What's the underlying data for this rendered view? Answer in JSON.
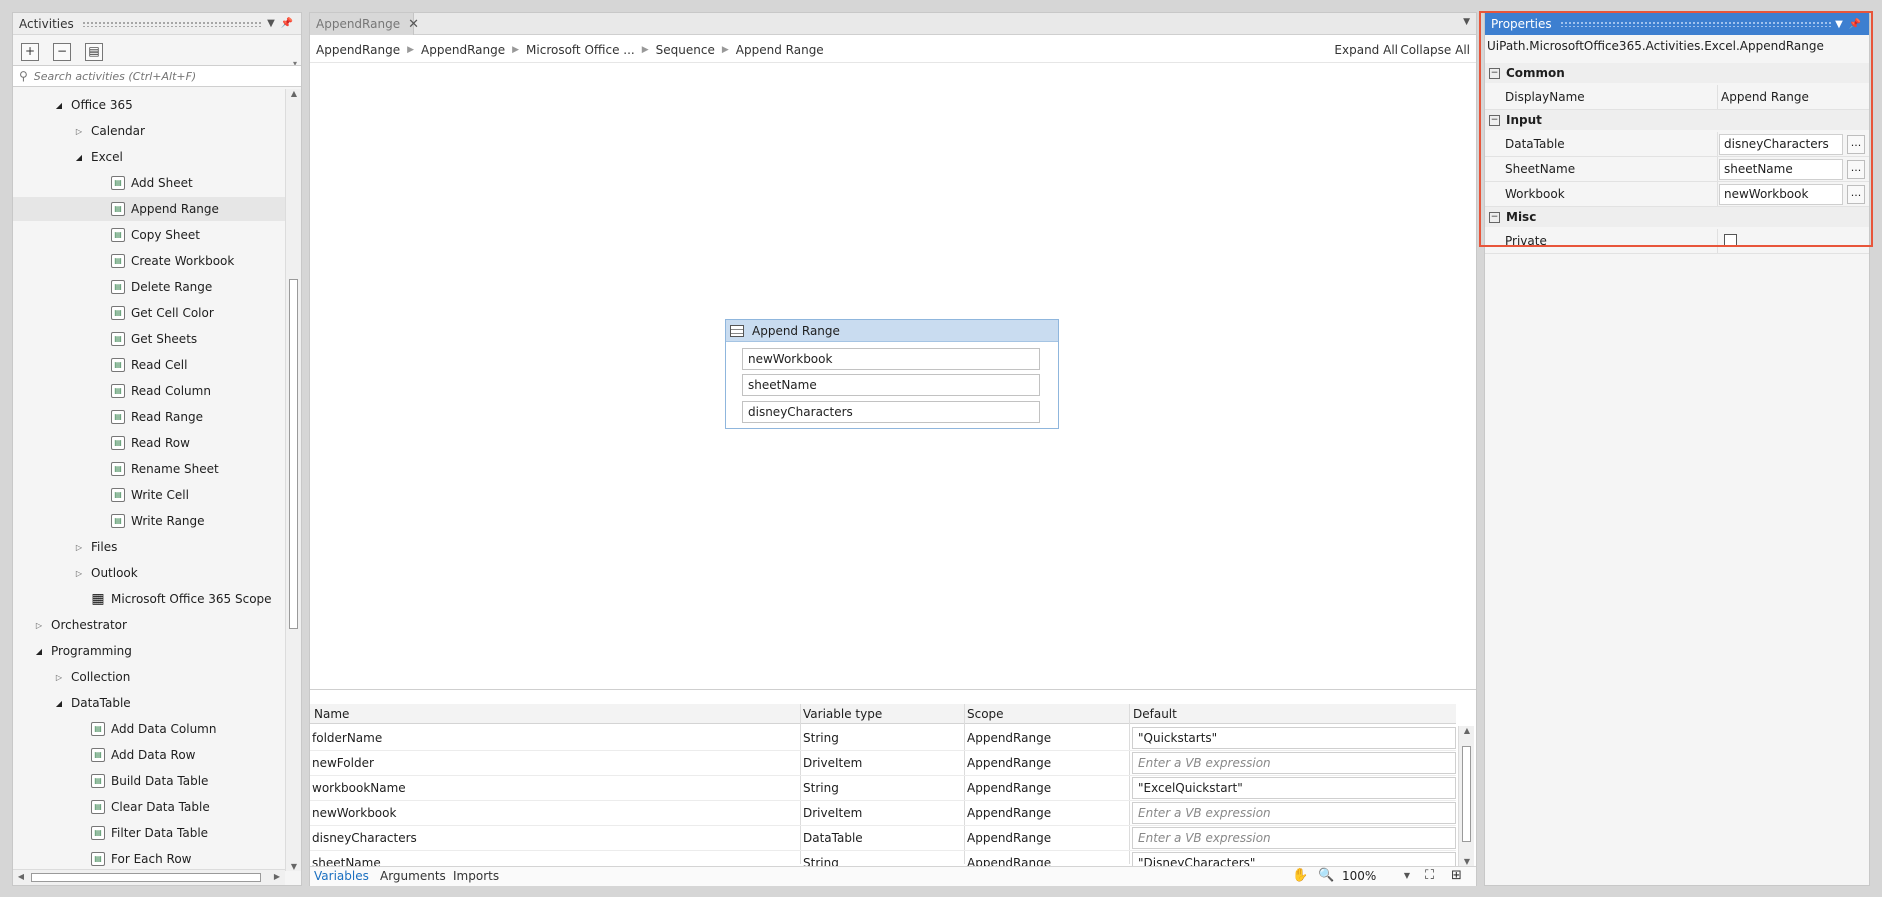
{
  "activities": {
    "title": "Activities",
    "search_placeholder": "Search activities (Ctrl+Alt+F)",
    "tree": [
      {
        "label": "Office 365",
        "indent": 1,
        "toggle": "open"
      },
      {
        "label": "Calendar",
        "indent": 2,
        "toggle": "closed"
      },
      {
        "label": "Excel",
        "indent": 2,
        "toggle": "open"
      },
      {
        "label": "Add Sheet",
        "indent": 3,
        "icon": "add-sheet-icon"
      },
      {
        "label": "Append Range",
        "indent": 3,
        "icon": "append-range-icon",
        "selected": true
      },
      {
        "label": "Copy Sheet",
        "indent": 3,
        "icon": "copy-sheet-icon"
      },
      {
        "label": "Create Workbook",
        "indent": 3,
        "icon": "create-workbook-icon"
      },
      {
        "label": "Delete Range",
        "indent": 3,
        "icon": "delete-range-icon"
      },
      {
        "label": "Get Cell Color",
        "indent": 3,
        "icon": "get-cell-color-icon"
      },
      {
        "label": "Get Sheets",
        "indent": 3,
        "icon": "get-sheets-icon"
      },
      {
        "label": "Read Cell",
        "indent": 3,
        "icon": "read-cell-icon"
      },
      {
        "label": "Read Column",
        "indent": 3,
        "icon": "read-column-icon"
      },
      {
        "label": "Read Range",
        "indent": 3,
        "icon": "read-range-icon"
      },
      {
        "label": "Read Row",
        "indent": 3,
        "icon": "read-row-icon"
      },
      {
        "label": "Rename Sheet",
        "indent": 3,
        "icon": "rename-sheet-icon"
      },
      {
        "label": "Write Cell",
        "indent": 3,
        "icon": "write-cell-icon"
      },
      {
        "label": "Write Range",
        "indent": 3,
        "icon": "write-range-icon"
      },
      {
        "label": "Files",
        "indent": 2,
        "toggle": "closed"
      },
      {
        "label": "Outlook",
        "indent": 2,
        "toggle": "closed"
      },
      {
        "label": "Microsoft Office 365 Scope",
        "indent": 2,
        "icon": "microsoft-logo-icon"
      },
      {
        "label": "Orchestrator",
        "indent": 0,
        "toggle": "closed"
      },
      {
        "label": "Programming",
        "indent": 0,
        "toggle": "open"
      },
      {
        "label": "Collection",
        "indent": 1,
        "toggle": "closed"
      },
      {
        "label": "DataTable",
        "indent": 1,
        "toggle": "open"
      },
      {
        "label": "Add Data Column",
        "indent": 2,
        "icon": "datatable-icon"
      },
      {
        "label": "Add Data Row",
        "indent": 2,
        "icon": "datatable-icon"
      },
      {
        "label": "Build Data Table",
        "indent": 2,
        "icon": "datatable-icon"
      },
      {
        "label": "Clear Data Table",
        "indent": 2,
        "icon": "datatable-icon"
      },
      {
        "label": "Filter Data Table",
        "indent": 2,
        "icon": "datatable-icon"
      },
      {
        "label": "For Each Row",
        "indent": 2,
        "icon": "datatable-icon"
      }
    ]
  },
  "designer": {
    "tab_label": "AppendRange",
    "breadcrumb": [
      "AppendRange",
      "AppendRange",
      "Microsoft Office ...",
      "Sequence",
      "Append Range"
    ],
    "expand_all": "Expand All",
    "collapse_all": "Collapse All",
    "activity": {
      "title": "Append Range",
      "fields": [
        "newWorkbook",
        "sheetName",
        "disneyCharacters"
      ]
    },
    "variables": {
      "columns": [
        "Name",
        "Variable type",
        "Scope",
        "Default"
      ],
      "rows": [
        {
          "name": "folderName",
          "type": "String",
          "scope": "AppendRange",
          "default": "\"Quickstarts\"",
          "placeholder": false
        },
        {
          "name": "newFolder",
          "type": "DriveItem",
          "scope": "AppendRange",
          "default": "Enter a VB expression",
          "placeholder": true
        },
        {
          "name": "workbookName",
          "type": "String",
          "scope": "AppendRange",
          "default": "\"ExcelQuickstart\"",
          "placeholder": false
        },
        {
          "name": "newWorkbook",
          "type": "DriveItem",
          "scope": "AppendRange",
          "default": "Enter a VB expression",
          "placeholder": true
        },
        {
          "name": "disneyCharacters",
          "type": "DataTable",
          "scope": "AppendRange",
          "default": "Enter a VB expression",
          "placeholder": true
        },
        {
          "name": "sheetName",
          "type": "String",
          "scope": "AppendRange",
          "default": "\"DisneyCharacters\"",
          "placeholder": false
        }
      ],
      "footer_tabs": [
        "Variables",
        "Arguments",
        "Imports"
      ],
      "zoom": "100%"
    }
  },
  "properties": {
    "title": "Properties",
    "type_name": "UiPath.MicrosoftOffice365.Activities.Excel.AppendRange",
    "categories": [
      {
        "name": "Common",
        "props": [
          {
            "name": "DisplayName",
            "value": "Append Range",
            "kind": "text"
          }
        ]
      },
      {
        "name": "Input",
        "props": [
          {
            "name": "DataTable",
            "value": "disneyCharacters",
            "kind": "input"
          },
          {
            "name": "SheetName",
            "value": "sheetName",
            "kind": "input"
          },
          {
            "name": "Workbook",
            "value": "newWorkbook",
            "kind": "input"
          }
        ]
      },
      {
        "name": "Misc",
        "props": [
          {
            "name": "Private",
            "value": false,
            "kind": "checkbox"
          }
        ]
      }
    ],
    "highlight_color": "#e8553a"
  }
}
